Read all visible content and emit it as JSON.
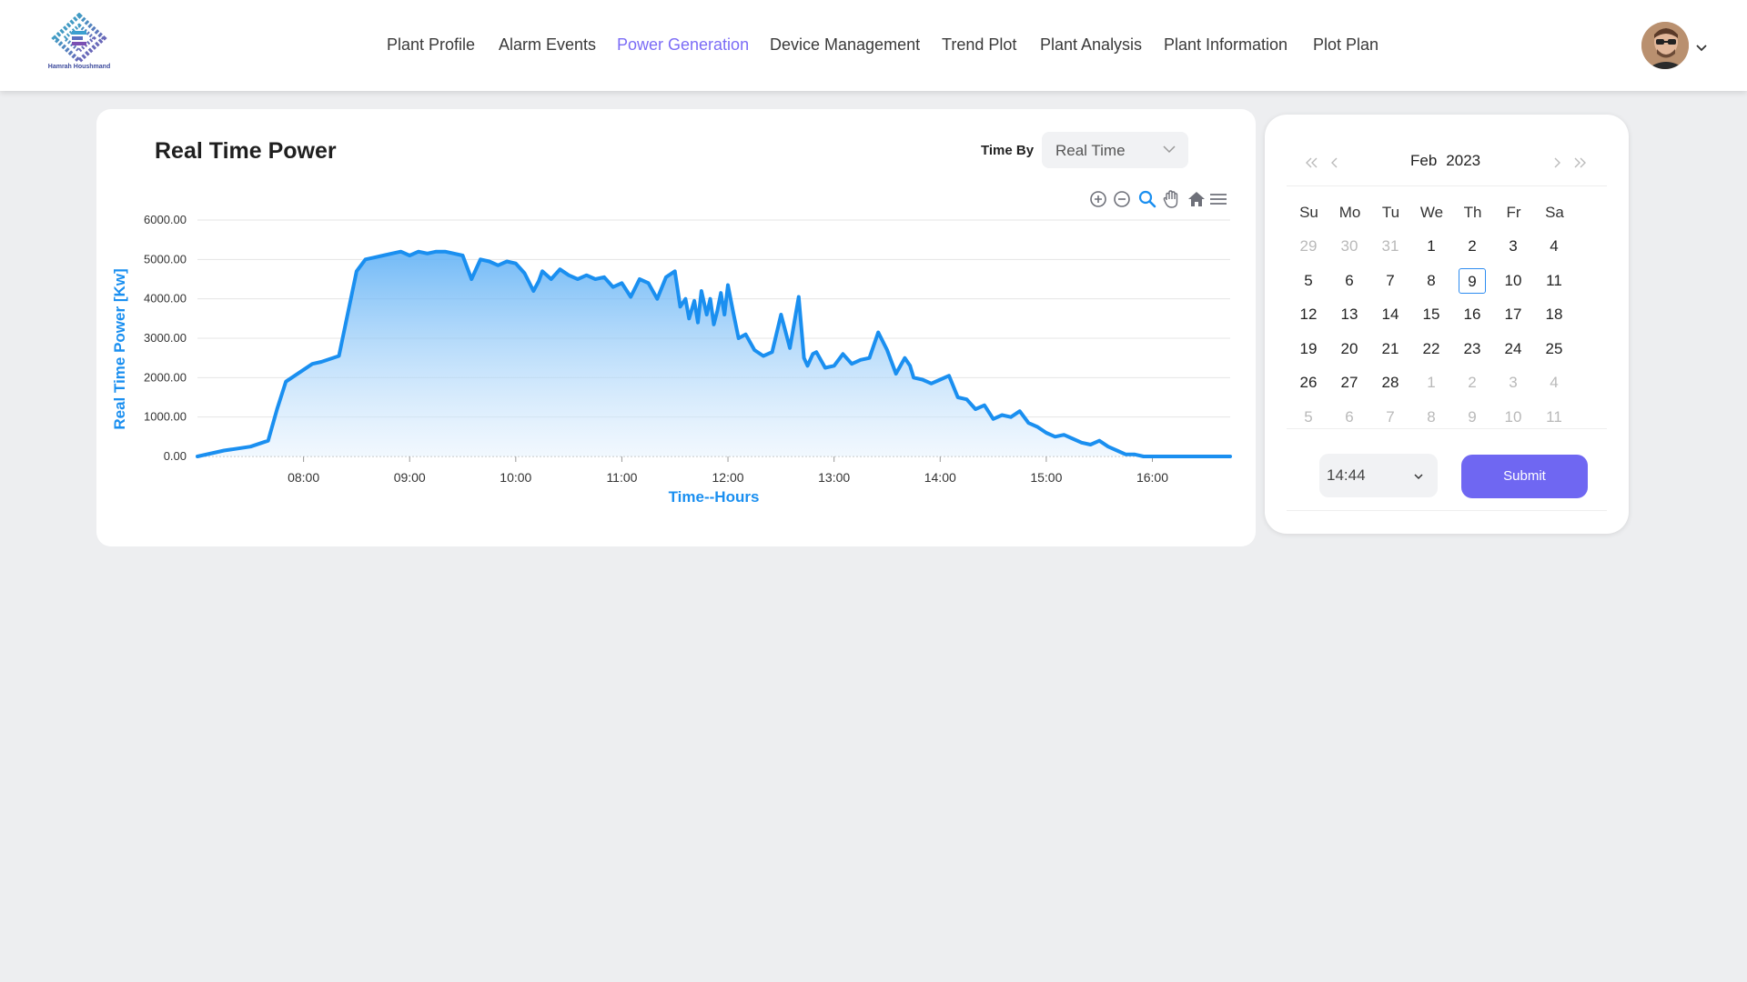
{
  "header": {
    "logo_text": "Hamrah Houshmand",
    "nav": [
      {
        "label": "Plant Profile",
        "active": false
      },
      {
        "label": "Alarm Events",
        "active": false
      },
      {
        "label": "Power Generation",
        "active": true
      },
      {
        "label": "Device Management",
        "active": false
      },
      {
        "label": "Trend Plot",
        "active": false
      },
      {
        "label": "Plant Analysis",
        "active": false
      },
      {
        "label": "Plant Information",
        "active": false
      },
      {
        "label": "Plot Plan",
        "active": false
      }
    ],
    "accent_color": "#7b6cf6"
  },
  "panel": {
    "title": "Real Time Power",
    "time_by_label": "Time By",
    "time_by_value": "Real Time",
    "toolbar_icons": [
      "zoom-in-icon",
      "zoom-out-icon",
      "selection-zoom-icon",
      "pan-icon",
      "reset-home-icon",
      "menu-icon"
    ]
  },
  "chart_data": {
    "type": "area",
    "title": "",
    "xlabel": "Time--Hours",
    "ylabel": "Real Time Power [Kw]",
    "ylim": [
      0,
      6000
    ],
    "xlim": [
      "07:00",
      "16:44"
    ],
    "y_ticks": [
      "0.00",
      "1000.00",
      "2000.00",
      "3000.00",
      "4000.00",
      "5000.00",
      "6000.00"
    ],
    "x_ticks": [
      "08:00",
      "09:00",
      "10:00",
      "11:00",
      "12:00",
      "13:00",
      "14:00",
      "15:00",
      "16:00"
    ],
    "grid": true,
    "line_color": "#1a8ff0",
    "series": [
      {
        "x": [
          "07:00",
          "07:15",
          "07:30",
          "07:40",
          "07:45",
          "07:50",
          "08:00",
          "08:05",
          "08:10",
          "08:20",
          "08:30",
          "08:35",
          "08:40",
          "08:45",
          "08:50",
          "08:55",
          "09:00",
          "09:05",
          "09:10",
          "09:15",
          "09:20",
          "09:25",
          "09:30",
          "09:35",
          "09:38",
          "09:40",
          "09:45",
          "09:50",
          "09:55",
          "10:00",
          "10:05",
          "10:10",
          "10:13",
          "10:15",
          "10:20",
          "10:25",
          "10:30",
          "10:35",
          "10:40",
          "10:45",
          "10:50",
          "10:55",
          "11:00",
          "11:05",
          "11:10",
          "11:15",
          "11:20",
          "11:25",
          "11:30",
          "11:33",
          "11:36",
          "11:38",
          "11:41",
          "11:43",
          "11:45",
          "11:48",
          "11:50",
          "11:52",
          "11:54",
          "11:56",
          "11:58",
          "12:00",
          "12:03",
          "12:06",
          "12:10",
          "12:15",
          "12:20",
          "12:25",
          "12:30",
          "12:35",
          "12:40",
          "12:43",
          "12:45",
          "12:48",
          "12:50",
          "12:55",
          "13:00",
          "13:05",
          "13:10",
          "13:15",
          "13:20",
          "13:25",
          "13:30",
          "13:35",
          "13:40",
          "13:43",
          "13:45",
          "13:50",
          "13:55",
          "14:00",
          "14:05",
          "14:10",
          "14:15",
          "14:20",
          "14:25",
          "14:30",
          "14:35",
          "14:40",
          "14:45",
          "14:50",
          "14:55",
          "15:00",
          "15:05",
          "15:10",
          "15:15",
          "15:20",
          "15:25",
          "15:30",
          "15:35",
          "15:40",
          "15:45",
          "15:50",
          "15:55",
          "16:00",
          "16:10",
          "16:20",
          "16:30",
          "16:44"
        ],
        "y": [
          0,
          150,
          250,
          400,
          1200,
          1900,
          2200,
          2350,
          2400,
          2550,
          4700,
          5000,
          5050,
          5100,
          5150,
          5200,
          5100,
          5200,
          5150,
          5200,
          5200,
          5150,
          5100,
          4500,
          4800,
          5000,
          4950,
          4850,
          4950,
          4900,
          4650,
          4200,
          4450,
          4700,
          4500,
          4750,
          4600,
          4500,
          4600,
          4500,
          4550,
          4300,
          4400,
          4050,
          4500,
          4400,
          4000,
          4550,
          4700,
          3800,
          4000,
          3500,
          3950,
          3400,
          4200,
          3600,
          4000,
          3350,
          3700,
          4150,
          3600,
          4350,
          3650,
          3000,
          3100,
          2700,
          2550,
          2650,
          3600,
          2750,
          4050,
          2500,
          2300,
          2600,
          2650,
          2250,
          2300,
          2600,
          2350,
          2450,
          2500,
          3150,
          2700,
          2100,
          2500,
          2300,
          2000,
          1950,
          1850,
          1950,
          2050,
          1500,
          1450,
          1200,
          1300,
          950,
          1050,
          1000,
          1150,
          850,
          750,
          600,
          500,
          550,
          450,
          350,
          300,
          400,
          250,
          150,
          50,
          50,
          0,
          0,
          0,
          0,
          0,
          0
        ]
      }
    ]
  },
  "calendar": {
    "month": "Feb",
    "year": "2023",
    "weekdays": [
      "Su",
      "Mo",
      "Tu",
      "We",
      "Th",
      "Fr",
      "Sa"
    ],
    "weeks": [
      [
        {
          "d": "29",
          "m": true
        },
        {
          "d": "30",
          "m": true
        },
        {
          "d": "31",
          "m": true
        },
        {
          "d": "1"
        },
        {
          "d": "2"
        },
        {
          "d": "3"
        },
        {
          "d": "4"
        }
      ],
      [
        {
          "d": "5"
        },
        {
          "d": "6"
        },
        {
          "d": "7"
        },
        {
          "d": "8"
        },
        {
          "d": "9",
          "today": true
        },
        {
          "d": "10"
        },
        {
          "d": "11"
        }
      ],
      [
        {
          "d": "12"
        },
        {
          "d": "13"
        },
        {
          "d": "14"
        },
        {
          "d": "15"
        },
        {
          "d": "16"
        },
        {
          "d": "17"
        },
        {
          "d": "18"
        }
      ],
      [
        {
          "d": "19"
        },
        {
          "d": "20"
        },
        {
          "d": "21"
        },
        {
          "d": "22"
        },
        {
          "d": "23"
        },
        {
          "d": "24"
        },
        {
          "d": "25"
        }
      ],
      [
        {
          "d": "26"
        },
        {
          "d": "27"
        },
        {
          "d": "28"
        },
        {
          "d": "1",
          "m": true
        },
        {
          "d": "2",
          "m": true
        },
        {
          "d": "3",
          "m": true
        },
        {
          "d": "4",
          "m": true
        }
      ],
      [
        {
          "d": "5",
          "m": true
        },
        {
          "d": "6",
          "m": true
        },
        {
          "d": "7",
          "m": true
        },
        {
          "d": "8",
          "m": true
        },
        {
          "d": "9",
          "m": true
        },
        {
          "d": "10",
          "m": true
        },
        {
          "d": "11",
          "m": true
        }
      ]
    ],
    "time_value": "14:44",
    "submit_label": "Submit",
    "submit_color": "#6f67f2"
  }
}
